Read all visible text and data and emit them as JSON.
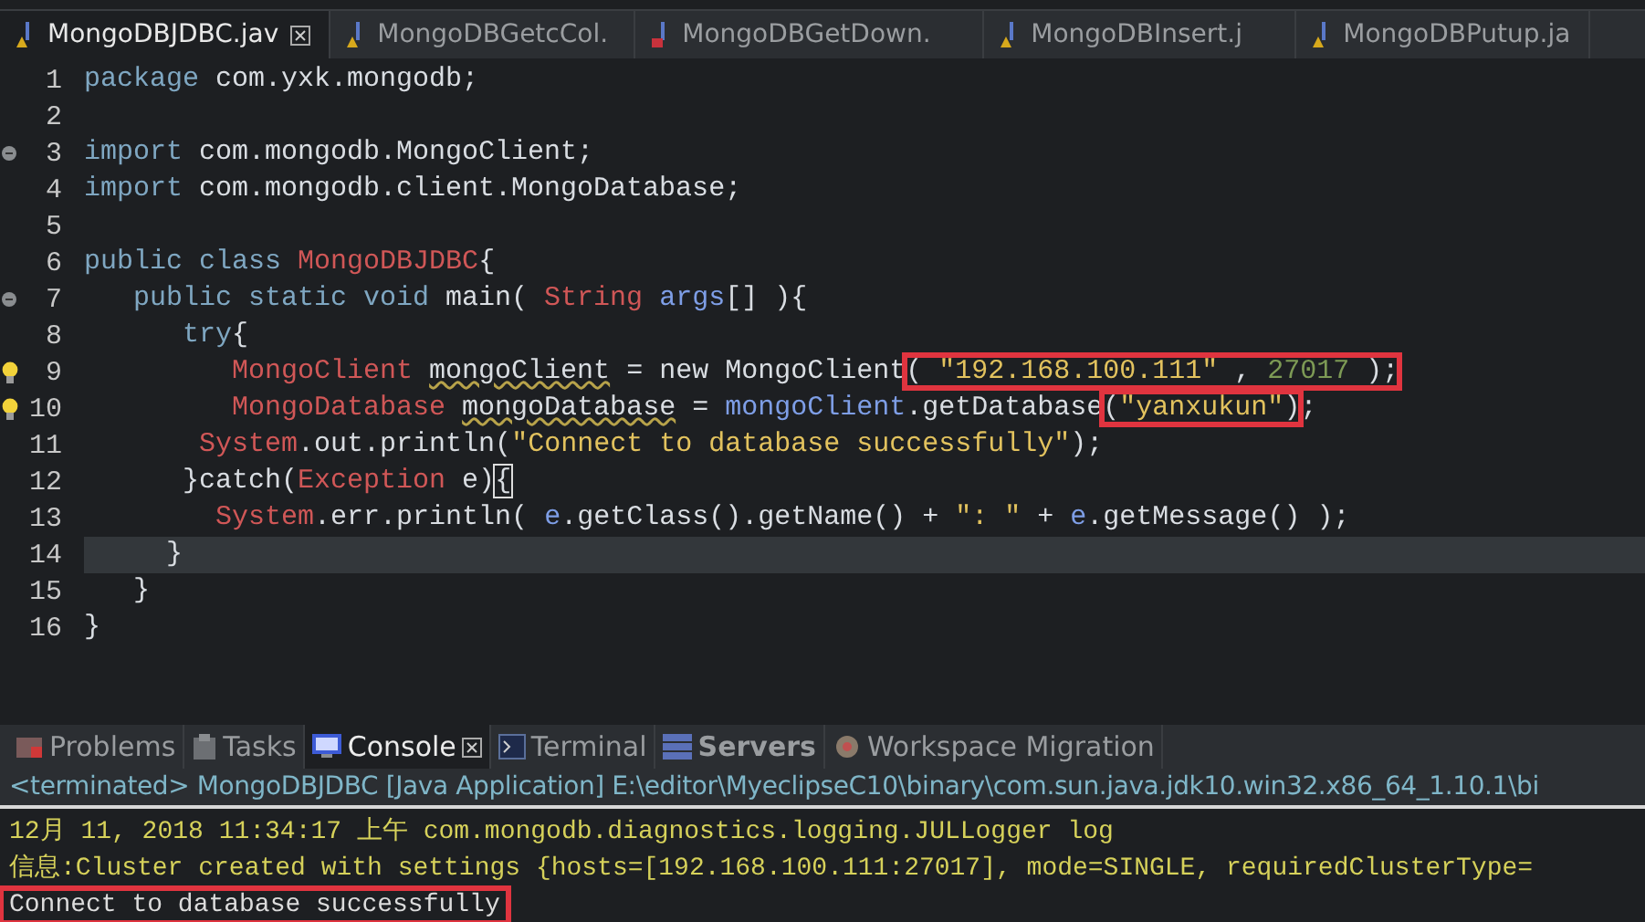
{
  "editor_tabs": [
    {
      "label": "MongoDBJDBC.jav",
      "selected": true,
      "kind": "warning",
      "closable": true
    },
    {
      "label": "MongoDBGetcCol.",
      "selected": false,
      "kind": "warning",
      "closable": false
    },
    {
      "label": "MongoDBGetDown.",
      "selected": false,
      "kind": "error",
      "closable": false
    },
    {
      "label": "MongoDBInsert.j",
      "selected": false,
      "kind": "warning",
      "closable": false
    },
    {
      "label": "MongoDBPutup.ja",
      "selected": false,
      "kind": "warning",
      "closable": false
    }
  ],
  "code_lines": [
    {
      "number": "1",
      "kind": "plain",
      "current": false,
      "segments": [
        {
          "boxed": false,
          "tokens": [
            {
              "text": "package",
              "kind": "keyword"
            },
            {
              "text": " com.yxk.mongodb;",
              "kind": "plain"
            }
          ]
        }
      ]
    },
    {
      "number": "2",
      "kind": "plain",
      "current": false
    },
    {
      "number": "3",
      "kind": "fold",
      "current": false,
      "segments": [
        {
          "boxed": false,
          "tokens": [
            {
              "text": "import",
              "kind": "keyword"
            },
            {
              "text": " com.mongodb.MongoClient;",
              "kind": "plain"
            }
          ]
        }
      ]
    },
    {
      "number": "4",
      "kind": "plain",
      "current": false,
      "segments": [
        {
          "boxed": false,
          "tokens": [
            {
              "text": "import",
              "kind": "keyword"
            },
            {
              "text": " com.mongodb.client.MongoDatabase;",
              "kind": "plain"
            }
          ]
        }
      ]
    },
    {
      "number": "5",
      "kind": "plain",
      "current": false
    },
    {
      "number": "6",
      "kind": "plain",
      "current": false,
      "segments": [
        {
          "boxed": false,
          "tokens": [
            {
              "text": "public class ",
              "kind": "keyword"
            },
            {
              "text": "MongoDBJDBC",
              "kind": "type"
            },
            {
              "text": "{",
              "kind": "plain"
            }
          ]
        }
      ]
    },
    {
      "number": "7",
      "kind": "fold",
      "current": false,
      "segments": [
        {
          "boxed": false,
          "tokens": [
            {
              "text": "   public static void",
              "kind": "keyword"
            },
            {
              "text": " main( ",
              "kind": "plain"
            },
            {
              "text": "String ",
              "kind": "type"
            },
            {
              "text": "args",
              "kind": "variable"
            },
            {
              "text": "[] ){",
              "kind": "plain"
            }
          ]
        }
      ]
    },
    {
      "number": "8",
      "kind": "plain",
      "current": false,
      "segments": [
        {
          "boxed": false,
          "tokens": [
            {
              "text": "      try",
              "kind": "keyword"
            },
            {
              "text": "{",
              "kind": "plain"
            }
          ]
        }
      ]
    },
    {
      "number": "9",
      "kind": "bulb",
      "current": false,
      "segments": [
        {
          "boxed": false,
          "tokens": [
            {
              "text": "         MongoClient ",
              "kind": "type"
            },
            {
              "text": "mongoClient",
              "kind": "warning"
            },
            {
              "text": " = new MongoClient",
              "kind": "plain"
            }
          ]
        },
        {
          "boxed": true,
          "tokens": [
            {
              "text": "( ",
              "kind": "plain"
            },
            {
              "text": "\"192.168.100.111\"",
              "kind": "string"
            },
            {
              "text": " , ",
              "kind": "plain"
            },
            {
              "text": "27017",
              "kind": "number"
            },
            {
              "text": " );",
              "kind": "plain"
            }
          ]
        }
      ]
    },
    {
      "number": "10",
      "kind": "bulb",
      "current": false,
      "segments": [
        {
          "boxed": false,
          "tokens": [
            {
              "text": "         MongoDatabase ",
              "kind": "type"
            },
            {
              "text": "mongoDatabase",
              "kind": "warning"
            },
            {
              "text": " = ",
              "kind": "plain"
            },
            {
              "text": "mongoClient",
              "kind": "variable"
            },
            {
              "text": ".getDatabase",
              "kind": "plain"
            }
          ]
        },
        {
          "boxed": true,
          "tokens": [
            {
              "text": "(",
              "kind": "plain"
            },
            {
              "text": "\"yanxukun\"",
              "kind": "string"
            },
            {
              "text": ")",
              "kind": "plain"
            }
          ]
        },
        {
          "boxed": false,
          "tokens": [
            {
              "text": ";",
              "kind": "plain"
            }
          ]
        }
      ]
    },
    {
      "number": "11",
      "kind": "plain",
      "current": false,
      "segments": [
        {
          "boxed": false,
          "tokens": [
            {
              "text": "       System",
              "kind": "type"
            },
            {
              "text": ".out.println(",
              "kind": "plain"
            },
            {
              "text": "\"Connect to database successfully\"",
              "kind": "string"
            },
            {
              "text": ");",
              "kind": "plain"
            }
          ]
        }
      ]
    },
    {
      "number": "12",
      "kind": "plain",
      "current": false,
      "segments": [
        {
          "boxed": false,
          "tokens": [
            {
              "text": "      }catch(",
              "kind": "plain"
            },
            {
              "text": "Exception",
              "kind": "type"
            },
            {
              "text": " e)",
              "kind": "plain"
            },
            {
              "text": "{",
              "kind": "bracket_match"
            }
          ]
        }
      ]
    },
    {
      "number": "13",
      "kind": "plain",
      "current": false,
      "segments": [
        {
          "boxed": false,
          "tokens": [
            {
              "text": "        System",
              "kind": "type"
            },
            {
              "text": ".err.println( ",
              "kind": "plain"
            },
            {
              "text": "e",
              "kind": "variable"
            },
            {
              "text": ".getClass().getName() + ",
              "kind": "plain"
            },
            {
              "text": "\": \"",
              "kind": "string"
            },
            {
              "text": " + ",
              "kind": "plain"
            },
            {
              "text": "e",
              "kind": "variable"
            },
            {
              "text": ".getMessage() );",
              "kind": "plain"
            }
          ]
        }
      ]
    },
    {
      "number": "14",
      "kind": "plain",
      "current": true,
      "segments": [
        {
          "boxed": false,
          "tokens": [
            {
              "text": "     }",
              "kind": "plain"
            }
          ]
        }
      ]
    },
    {
      "number": "15",
      "kind": "plain",
      "current": false,
      "segments": [
        {
          "boxed": false,
          "tokens": [
            {
              "text": "   }",
              "kind": "plain"
            }
          ]
        }
      ]
    },
    {
      "number": "16",
      "kind": "plain",
      "current": false,
      "segments": [
        {
          "boxed": false,
          "tokens": [
            {
              "text": "}",
              "kind": "plain"
            }
          ]
        }
      ]
    }
  ],
  "view_tabs": [
    {
      "label": "Problems",
      "selected": false,
      "bold": false,
      "closable": false
    },
    {
      "label": "Tasks",
      "selected": false,
      "bold": false,
      "closable": false
    },
    {
      "label": "Console",
      "selected": true,
      "bold": false,
      "closable": true
    },
    {
      "label": "Terminal",
      "selected": false,
      "bold": false,
      "closable": false
    },
    {
      "label": "Servers",
      "selected": false,
      "bold": true,
      "closable": false
    },
    {
      "label": "Workspace Migration",
      "selected": false,
      "bold": false,
      "closable": false
    }
  ],
  "console": {
    "process": "<terminated> MongoDBJDBC [Java Application] E:\\editor\\MyeclipseC10\\binary\\com.sun.java.jdk10.win32.x86_64_1.10.1\\bi",
    "lines": [
      {
        "text": "12月 11, 2018 11:34:17 上午 com.mongodb.diagnostics.logging.JULLogger log",
        "kind": "stderr",
        "boxed": false
      },
      {
        "text": "信息:Cluster created with settings {hosts=[192.168.100.111:27017], mode=SINGLE, requiredClusterType=",
        "kind": "stderr",
        "boxed": false
      },
      {
        "text": "Connect to database successfully",
        "kind": "stdout",
        "boxed": true
      }
    ]
  }
}
